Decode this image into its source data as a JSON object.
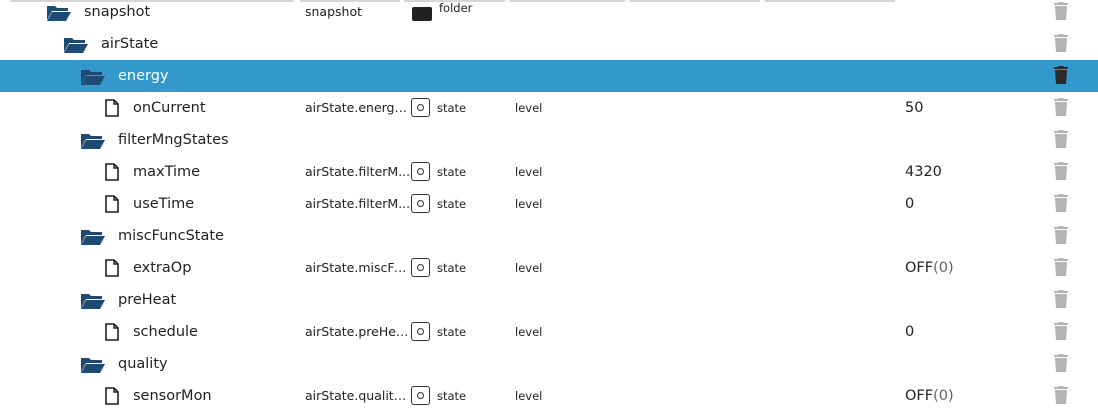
{
  "rows": [
    {
      "name": "snapshot",
      "kind": "folder",
      "depth": 0,
      "id": "snapshot",
      "type": "folder",
      "role": "",
      "value": "",
      "sub": ""
    },
    {
      "name": "airState",
      "kind": "folder",
      "depth": 1,
      "id": "",
      "type": "",
      "role": "",
      "value": "",
      "sub": ""
    },
    {
      "name": "energy",
      "kind": "folder",
      "depth": 2,
      "id": "",
      "type": "",
      "role": "",
      "value": "",
      "sub": "",
      "selected": true
    },
    {
      "name": "onCurrent",
      "kind": "state",
      "depth": 3,
      "id": "airState.energy....",
      "type": "state",
      "role": "level",
      "value": "50",
      "sub": ""
    },
    {
      "name": "filterMngStates",
      "kind": "folder",
      "depth": 2,
      "id": "",
      "type": "",
      "role": "",
      "value": "",
      "sub": ""
    },
    {
      "name": "maxTime",
      "kind": "state",
      "depth": 3,
      "id": "airState.filterM...",
      "type": "state",
      "role": "level",
      "value": "4320",
      "sub": ""
    },
    {
      "name": "useTime",
      "kind": "state",
      "depth": 3,
      "id": "airState.filterM...",
      "type": "state",
      "role": "level",
      "value": "0",
      "sub": ""
    },
    {
      "name": "miscFuncState",
      "kind": "folder",
      "depth": 2,
      "id": "",
      "type": "",
      "role": "",
      "value": "",
      "sub": ""
    },
    {
      "name": "extraOp",
      "kind": "state",
      "depth": 3,
      "id": "airState.miscFu...",
      "type": "state",
      "role": "level",
      "value": "OFF",
      "sub": "(0)"
    },
    {
      "name": "preHeat",
      "kind": "folder",
      "depth": 2,
      "id": "",
      "type": "",
      "role": "",
      "value": "",
      "sub": ""
    },
    {
      "name": "schedule",
      "kind": "state",
      "depth": 3,
      "id": "airState.preHea...",
      "type": "state",
      "role": "level",
      "value": "0",
      "sub": ""
    },
    {
      "name": "quality",
      "kind": "folder",
      "depth": 2,
      "id": "",
      "type": "",
      "role": "",
      "value": "",
      "sub": ""
    },
    {
      "name": "sensorMon",
      "kind": "state",
      "depth": 3,
      "id": "airState.quality....",
      "type": "state",
      "role": "level",
      "value": "OFF",
      "sub": "(0)"
    }
  ],
  "icons": {
    "folder": "folder-open-icon",
    "state": "file-icon",
    "delete": "trash-icon",
    "type": "state-type-icon"
  },
  "colors": {
    "selected_bg": "#3399cc",
    "folder_icon": "#1f4a73",
    "trash": "#b3b3b3"
  }
}
